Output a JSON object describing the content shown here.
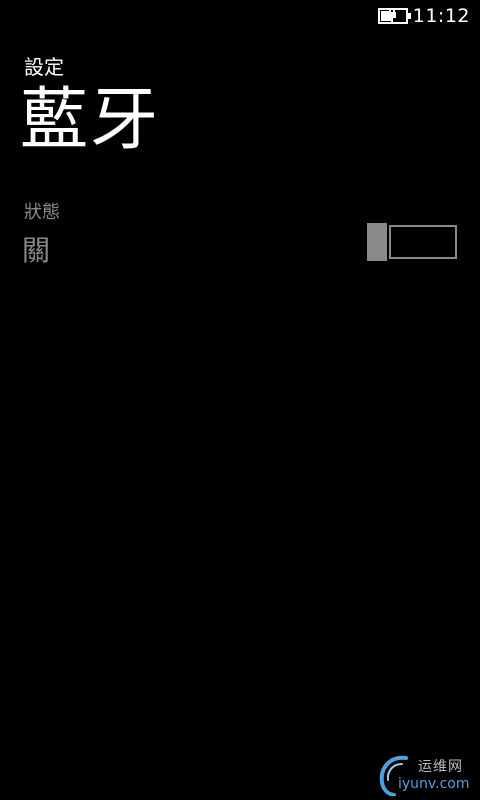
{
  "status_bar": {
    "time": "11:12",
    "battery_icon": "battery-charging-icon"
  },
  "header": {
    "app_title": "設定",
    "page_title": "藍牙"
  },
  "setting": {
    "label": "狀態",
    "value": "關",
    "toggle_on": false
  },
  "watermark": {
    "text": "运维网",
    "url": "iyunv.com",
    "logo_icon": "iyunv-swirl-logo"
  },
  "colors": {
    "background": "#000000",
    "foreground": "#ffffff",
    "disabled": "#8a8a8a",
    "watermark_blue": "#4aa3df"
  }
}
